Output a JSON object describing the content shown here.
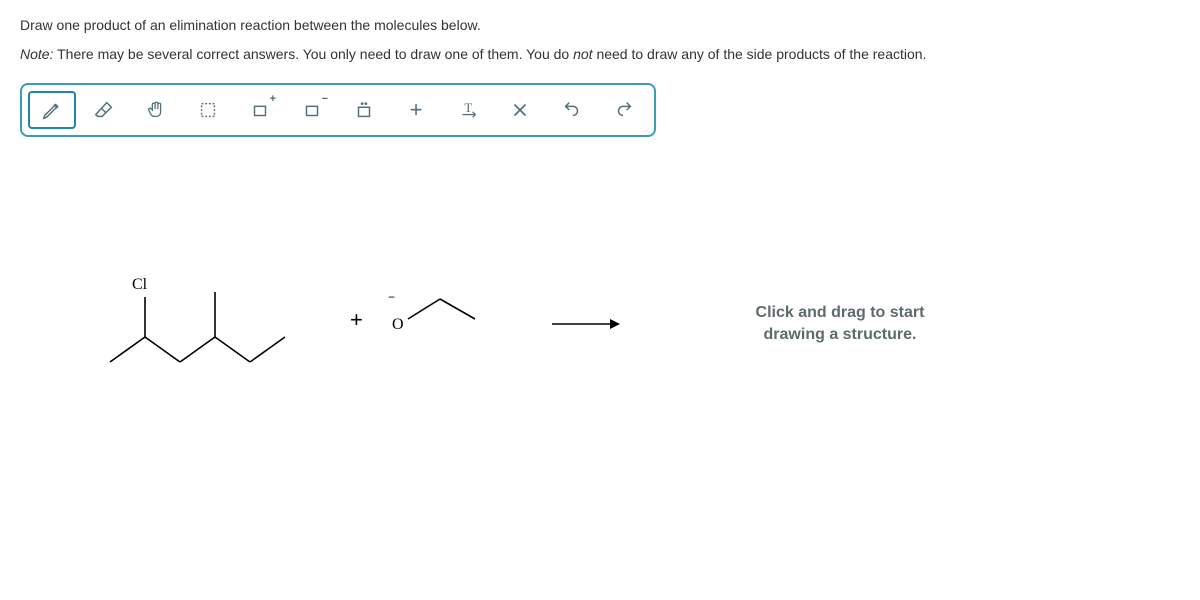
{
  "question_text": "Draw one product of an elimination reaction between the molecules below.",
  "note_prefix": "Note:",
  "note_text_part1": " There may be several correct answers. You only need to draw one of them. You do ",
  "note_emphasis": "not",
  "note_text_part2": " need to draw any of the side products of the reaction.",
  "toolbar": {
    "pencil": "pencil-tool",
    "eraser": "eraser-tool",
    "hand": "hand-tool",
    "select": "selection-tool",
    "pos_charge": "+",
    "neg_charge": "−",
    "lone_pair_top": "••",
    "plus": "+",
    "text_label": "T",
    "clear": "×",
    "undo": "↶",
    "redo": "↷"
  },
  "molecule": {
    "label_cl": "Cl",
    "label_o": "O",
    "neg_charge": "−"
  },
  "plus_op": "+",
  "hint_line1": "Click and drag to start",
  "hint_line2": "drawing a structure."
}
